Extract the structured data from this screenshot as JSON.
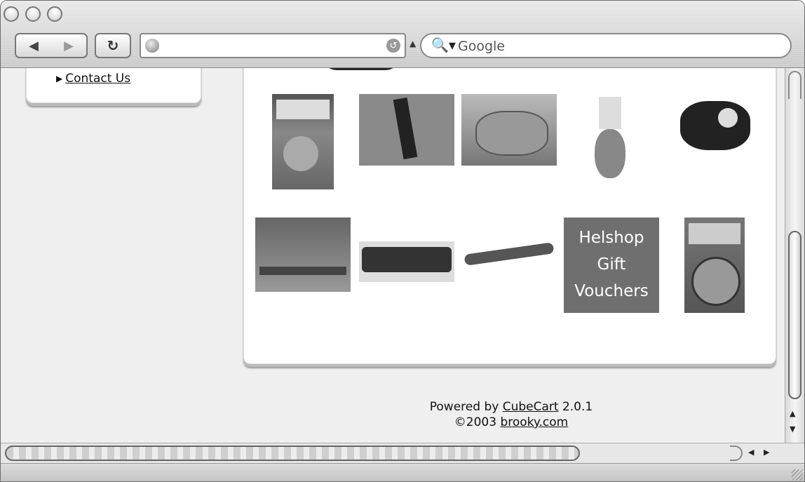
{
  "browser": {
    "search_placeholder": "Google",
    "back_icon": "◀",
    "forward_icon": "▶",
    "reload_icon": "C"
  },
  "sidebar": {
    "contact_label": "Contact Us"
  },
  "products": {
    "row1": [
      "mascara-pack",
      "knife-block",
      "saucepan-set",
      "cow-kitchen-tool",
      "air-compressor"
    ],
    "row2": [
      "chainsaw",
      "torque-wrench",
      "hose-gun",
      "gift-vouchers",
      "tape-measure"
    ],
    "voucher_text": [
      "Helshop",
      "Gift",
      "Vouchers"
    ]
  },
  "footer": {
    "powered_prefix": "Powered by ",
    "cubecart": "CubeCart",
    "version": " 2.0.1",
    "copyright": "©2003 ",
    "brooky": "brooky.com"
  }
}
